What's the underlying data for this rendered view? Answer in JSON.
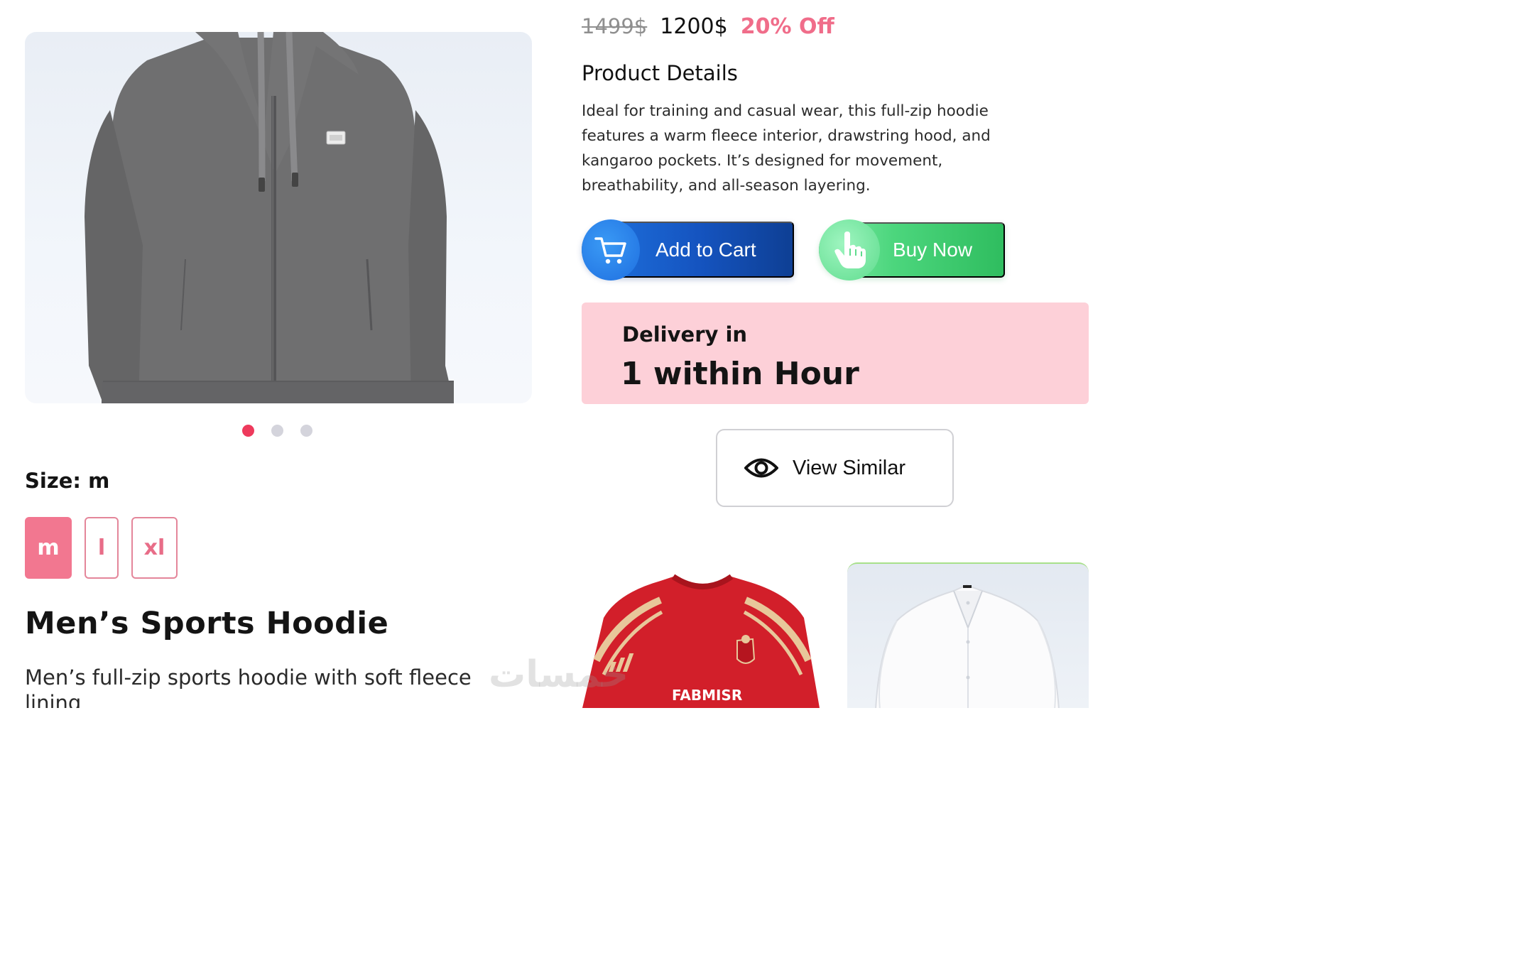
{
  "gallery": {
    "image_alt": "Grey full-zip hoodie",
    "slide_count": 3,
    "active_slide": 1
  },
  "size": {
    "label": "Size: m",
    "options": [
      "m",
      "l",
      "xl"
    ],
    "selected": "m"
  },
  "product": {
    "title": "Men’s Sports Hoodie",
    "subtitle": "Men’s full-zip sports hoodie with soft fleece lining"
  },
  "price": {
    "old": "1499$",
    "new": "1200$",
    "discount": "20% Off"
  },
  "details": {
    "heading": "Product Details",
    "text": "Ideal for training and casual wear, this full-zip hoodie features a warm fleece interior, drawstring hood, and kangaroo pockets. It’s designed for movement, breathability, and all-season layering."
  },
  "actions": {
    "add_to_cart": "Add to Cart",
    "buy_now": "Buy Now"
  },
  "delivery": {
    "label": "Delivery in",
    "value": "1 within Hour"
  },
  "view_similar": {
    "label": "View Similar"
  },
  "similar_products": {
    "jersey_sponsor": "FABMISR"
  },
  "watermark": "خمسات",
  "colors": {
    "accent_pink": "#f27790",
    "discount_pink": "#f06d8a",
    "cart_blue": "#1554c0",
    "buy_green": "#4cd67d",
    "delivery_bg": "#fdd0d8",
    "dot_active": "#ee3a5c"
  }
}
